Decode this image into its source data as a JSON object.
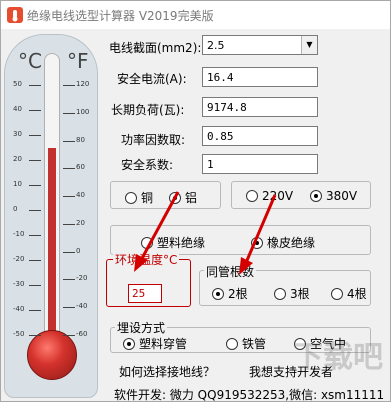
{
  "window": {
    "title": "绝缘电线选型计算器 V2019完美版"
  },
  "thermometer": {
    "celsius_symbol": "°C",
    "fahrenheit_symbol": "°F",
    "celsius_scale": [
      "50",
      "40",
      "30",
      "20",
      "10",
      "0",
      "-10",
      "-20",
      "-30",
      "-40",
      "-50"
    ],
    "fahrenheit_scale": [
      "120",
      "100",
      "80",
      "60",
      "40",
      "20",
      "0",
      "-20",
      "-40",
      "-60"
    ],
    "mercury_level_celsius": 25
  },
  "form": {
    "wire_section": {
      "label": "电线截面(mm2):",
      "value": "2.5"
    },
    "safe_current": {
      "label": "安全电流(A):",
      "value": "16.4"
    },
    "long_load": {
      "label": "长期负荷(瓦):",
      "value": "9174.8"
    },
    "power_factor": {
      "label": "功率因数取:",
      "value": "0.85"
    },
    "safety_factor": {
      "label": "安全系数:",
      "value": "1"
    }
  },
  "material": {
    "copper": "铜",
    "aluminum": "铝",
    "selected": "aluminum"
  },
  "voltage": {
    "v220": "220V",
    "v380": "380V",
    "selected": "v380"
  },
  "insulation": {
    "plastic": "塑料绝缘",
    "rubber": "橡皮绝缘",
    "selected": "rubber"
  },
  "ambient_temp": {
    "label": "环境温度°C",
    "value": "25"
  },
  "conduit_count": {
    "label": "同管根数",
    "options": [
      "2根",
      "3根",
      "4根"
    ],
    "selected": "2根"
  },
  "laying": {
    "label": "埋设方式",
    "options": [
      "塑料穿管",
      "铁管",
      "空气中"
    ],
    "selected": "塑料穿管"
  },
  "footer": {
    "ground_link": "如何选择接地线？",
    "support_link": "我想支持开发者",
    "developer": "软件开发: 微力 QQ919532253,微信: xsm11111"
  },
  "colors": {
    "mercury": "#c0312f",
    "annotation": "#d40000"
  }
}
